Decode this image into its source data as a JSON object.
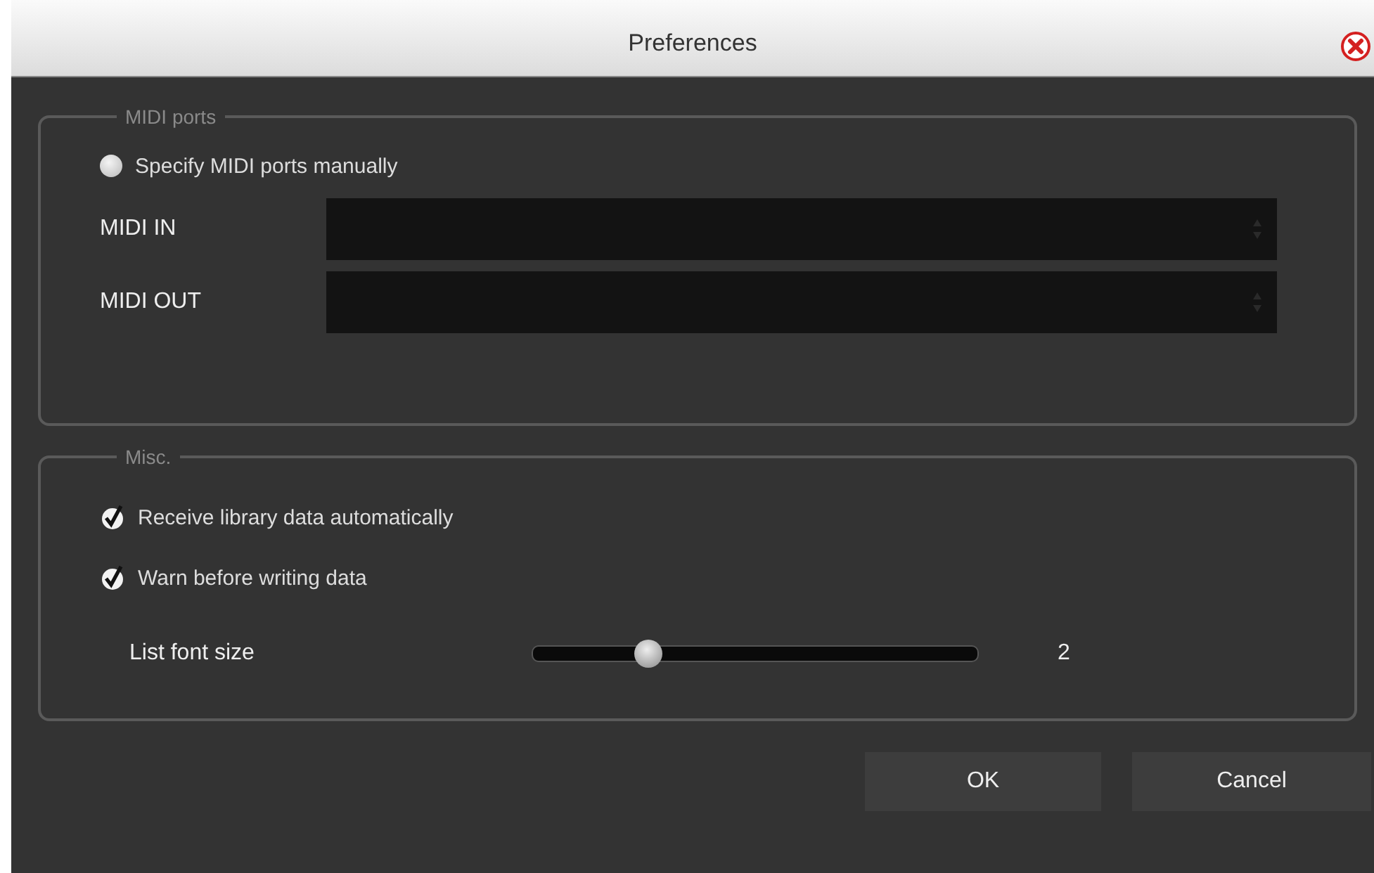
{
  "window": {
    "title": "Preferences"
  },
  "midi_ports": {
    "legend": "MIDI ports",
    "manual_radio": {
      "label": "Specify MIDI ports manually",
      "selected": false
    },
    "fields": [
      {
        "label": "MIDI IN"
      },
      {
        "label": "MIDI OUT"
      }
    ]
  },
  "misc": {
    "legend": "Misc.",
    "checkboxes": [
      {
        "label": "Receive library data automatically",
        "checked": true
      },
      {
        "label": "Warn before writing data",
        "checked": true
      }
    ],
    "slider": {
      "label": "List font size",
      "level": 0.26,
      "reading": "2"
    }
  },
  "buttons": [
    {
      "label": "OK"
    },
    {
      "label": "Cancel"
    }
  ]
}
